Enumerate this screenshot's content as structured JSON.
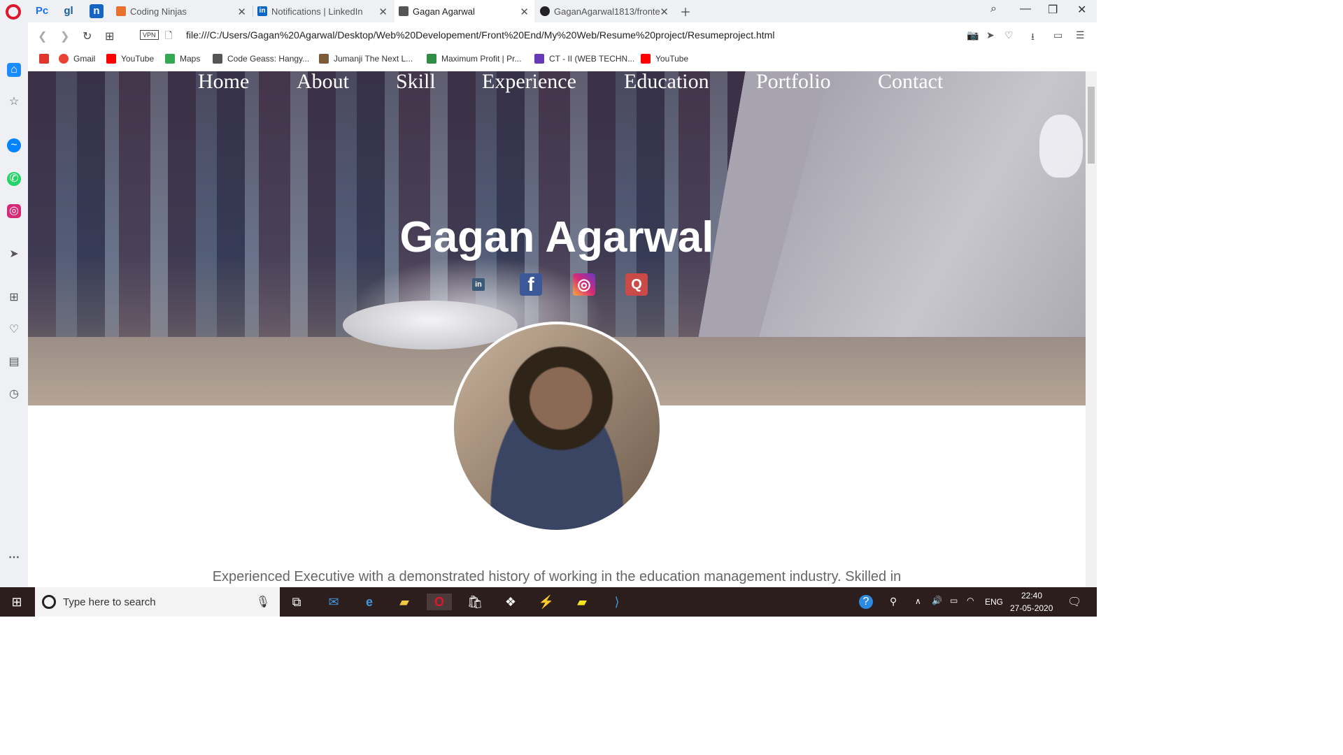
{
  "browser": {
    "tabs": [
      {
        "label": "Coding Ninjas",
        "icon": "coding-ninjas-icon"
      },
      {
        "label": "Notifications | LinkedIn",
        "icon": "linkedin-icon"
      },
      {
        "label": "Gagan Agarwal",
        "icon": "document-icon",
        "active": true
      },
      {
        "label": "GaganAgarwal1813/fronte",
        "icon": "github-icon"
      }
    ],
    "url": "file:///C:/Users/Gagan%20Agarwal/Desktop/Web%20Developement/Front%20End/My%20Web/Resume%20project/Resumeproject.html",
    "vpn_label": "VPN",
    "bookmarks": [
      {
        "label": "Gmail",
        "color": "#ea4335"
      },
      {
        "label": "YouTube",
        "color": "#ff0000"
      },
      {
        "label": "Maps",
        "color": "#34a853"
      },
      {
        "label": "Code Geass: Hangy...",
        "color": "#555555"
      },
      {
        "label": "Jumanji The Next L...",
        "color": "#7a5c3a"
      },
      {
        "label": "Maximum Profit | Pr...",
        "color": "#2f8d46"
      },
      {
        "label": "CT - II (WEB TECHN...",
        "color": "#673ab7"
      },
      {
        "label": "YouTube",
        "color": "#ff0000"
      }
    ]
  },
  "site": {
    "nav": [
      "Home",
      "About",
      "Skill",
      "Experience",
      "Education",
      "Portfolio",
      "Contact"
    ],
    "name": "Gagan Agarwal",
    "social": [
      {
        "icon": "linkedin-icon",
        "glyph": "in",
        "color": "#3b5a78"
      },
      {
        "icon": "facebook-icon",
        "glyph": "f",
        "color": "#3b5998"
      },
      {
        "icon": "instagram-icon",
        "glyph": "◎",
        "color": "#c13584"
      },
      {
        "icon": "quora-icon",
        "glyph": "Q",
        "color": "#b92b27"
      }
    ],
    "bio": "Experienced Executive with a demonstrated history of working in the education management industry. Skilled in"
  },
  "taskbar": {
    "search_placeholder": "Type here to search",
    "language": "ENG",
    "time": "22:40",
    "date": "27-05-2020"
  }
}
